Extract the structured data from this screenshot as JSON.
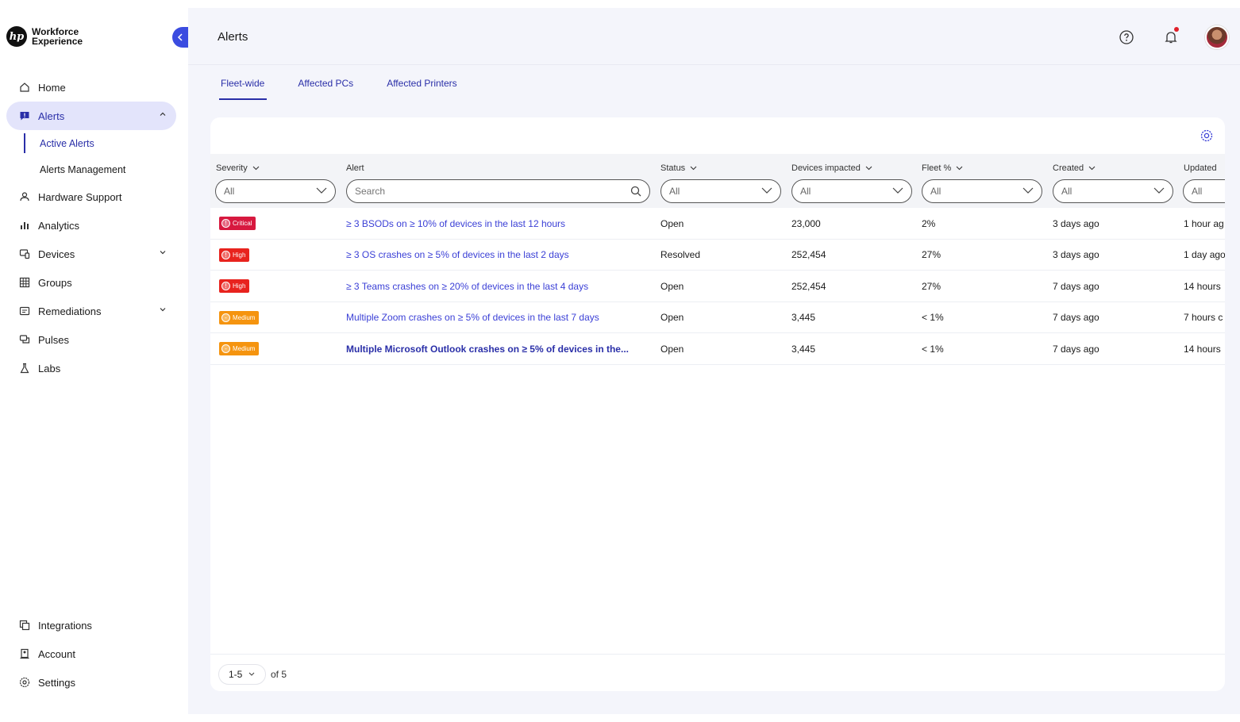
{
  "brand": {
    "logo_mark": "hp",
    "name": "Workforce Experience"
  },
  "sidebar": {
    "items": [
      {
        "label": "Home",
        "icon": "home-icon"
      },
      {
        "label": "Alerts",
        "icon": "alert-icon",
        "active": true,
        "expanded": true
      },
      {
        "label": "Hardware Support",
        "icon": "hardware-support-icon"
      },
      {
        "label": "Analytics",
        "icon": "analytics-icon"
      },
      {
        "label": "Devices",
        "icon": "devices-icon",
        "expandable": true
      },
      {
        "label": "Groups",
        "icon": "groups-icon"
      },
      {
        "label": "Remediations",
        "icon": "remediations-icon",
        "expandable": true
      },
      {
        "label": "Pulses",
        "icon": "pulses-icon"
      },
      {
        "label": "Labs",
        "icon": "labs-icon"
      }
    ],
    "alerts_sub": [
      {
        "label": "Active Alerts",
        "active": true
      },
      {
        "label": "Alerts Management"
      }
    ],
    "bottom": [
      {
        "label": "Integrations",
        "icon": "integrations-icon"
      },
      {
        "label": "Account",
        "icon": "account-icon"
      },
      {
        "label": "Settings",
        "icon": "settings-icon"
      }
    ]
  },
  "header": {
    "title": "Alerts"
  },
  "tabs": [
    {
      "label": "Fleet-wide",
      "active": true
    },
    {
      "label": "Affected PCs"
    },
    {
      "label": "Affected Printers"
    }
  ],
  "table": {
    "columns": [
      {
        "label": "Severity",
        "filter": "All"
      },
      {
        "label": "Alert",
        "filter_placeholder": "Search"
      },
      {
        "label": "Status",
        "filter": "All"
      },
      {
        "label": "Devices impacted",
        "filter": "All"
      },
      {
        "label": "Fleet %",
        "filter": "All"
      },
      {
        "label": "Created",
        "filter": "All"
      },
      {
        "label": "Updated",
        "filter": "All"
      }
    ],
    "rows": [
      {
        "severity": "Critical",
        "alert": "≥ 3 BSODs on ≥ 10% of devices in the last 12 hours",
        "status": "Open",
        "devices": "23,000",
        "fleet": "2%",
        "created": "3 days ago",
        "updated": "1 hour ag"
      },
      {
        "severity": "High",
        "alert": "≥ 3 OS crashes on ≥ 5% of devices in the last 2 days",
        "status": "Resolved",
        "devices": "252,454",
        "fleet": "27%",
        "created": "3 days ago",
        "updated": "1 day ago"
      },
      {
        "severity": "High",
        "alert": "≥ 3 Teams crashes on ≥ 20% of devices in the last 4 days",
        "status": "Open",
        "devices": "252,454",
        "fleet": "27%",
        "created": "7 days ago",
        "updated": "14 hours"
      },
      {
        "severity": "Medium",
        "alert": "Multiple Zoom crashes on ≥ 5% of devices in the last 7 days",
        "status": "Open",
        "devices": "3,445",
        "fleet": "< 1%",
        "created": "7 days ago",
        "updated": "7 hours c"
      },
      {
        "severity": "Medium",
        "alert": "Multiple Microsoft Outlook crashes on ≥ 5% of devices in the...",
        "status": "Open",
        "devices": "3,445",
        "fleet": "< 1%",
        "created": "7 days ago",
        "updated": "14 hours"
      }
    ]
  },
  "pagination": {
    "range": "1-5",
    "of": "of 5"
  },
  "colors": {
    "accent": "#2a2fa8",
    "critical": "#d7193f",
    "high": "#e8231e",
    "medium": "#f5940f",
    "notification_dot": "#e0202a"
  }
}
